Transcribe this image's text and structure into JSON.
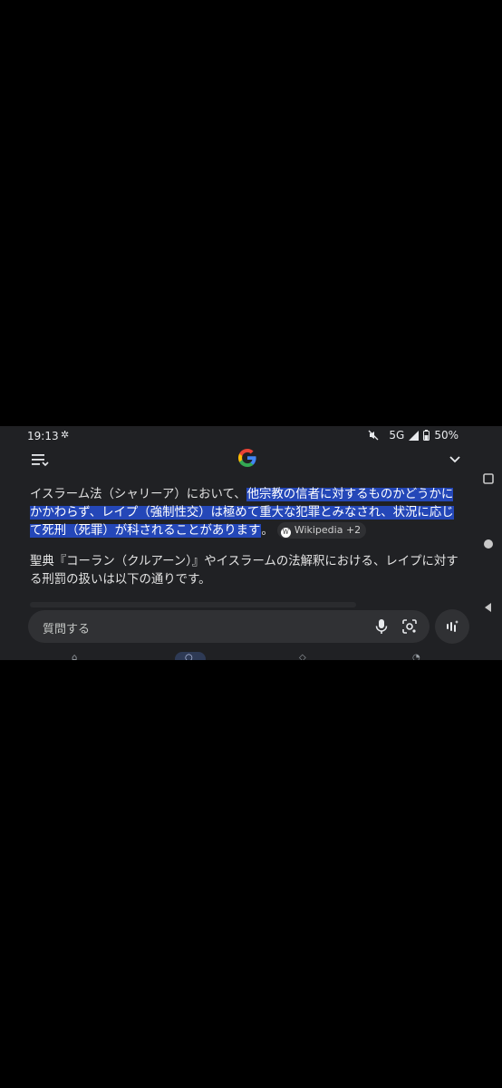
{
  "status_bar": {
    "time": "19:13",
    "network": "5G",
    "battery": "50%"
  },
  "answer": {
    "lead": "イスラーム法（シャリーア）において、",
    "highlight": "他宗教の信者に対するものかどうかにかかわらず、レイプ（強制性交）は極めて重大な犯罪とみなされ、状況に応じて死刑（死罪）が科されることがあります",
    "tail": "。",
    "source_chip": "Wikipedia +2",
    "paragraph2": "聖典『コーラン（クルアーン）』やイスラームの法解釈における、レイプに対する刑罰の扱いは以下の通りです。"
  },
  "ask_bar": {
    "placeholder": "質問する"
  },
  "colors": {
    "background": "#202124",
    "highlight": "#2447b8",
    "bar": "#303134"
  }
}
